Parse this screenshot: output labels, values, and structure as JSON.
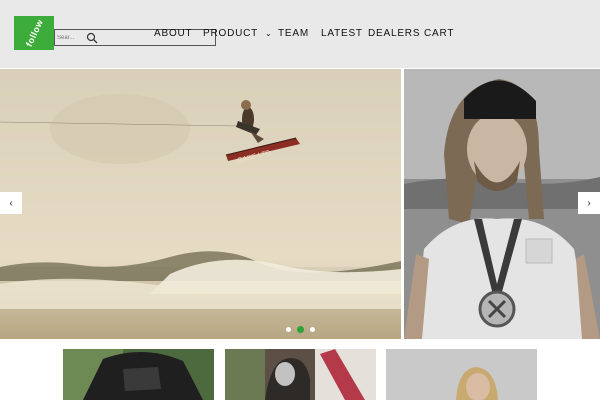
{
  "brand": {
    "logo_text": "follow",
    "accent": "#3cad3a"
  },
  "search": {
    "placeholder": "Sear..."
  },
  "nav": [
    {
      "label": "ABOUT"
    },
    {
      "label": "PRODUCT",
      "has_dropdown": true
    },
    {
      "label": "TEAM"
    },
    {
      "label": "LATEST"
    },
    {
      "label": "DEALERS"
    },
    {
      "label": "CART"
    }
  ],
  "hero": {
    "main_image": "wakeboarder-jumping-photo",
    "side_image": "rider-portrait-with-medal-photo",
    "board_text": "CASE LTD",
    "dots": 3,
    "active_dot": 2
  },
  "thumbs": [
    "rider-vest-photo",
    "gloved-hand-photo",
    "blonde-rider-photo"
  ]
}
